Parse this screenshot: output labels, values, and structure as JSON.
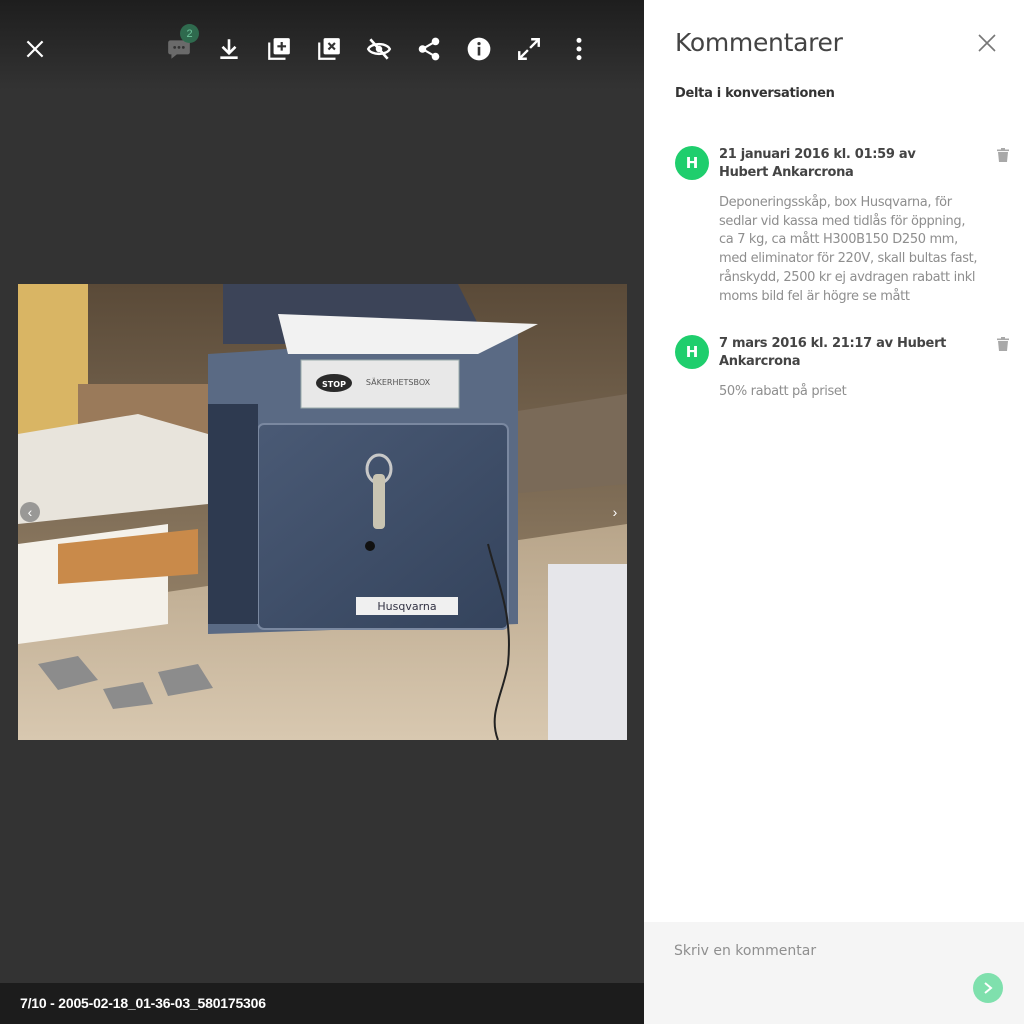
{
  "toolbar": {
    "comment_count": "2",
    "icons": [
      "close-icon",
      "comments-icon",
      "download-icon",
      "add-to-album-icon",
      "remove-from-album-icon",
      "hide-icon",
      "share-icon",
      "info-icon",
      "fullscreen-icon",
      "more-icon"
    ]
  },
  "viewer": {
    "caption": "7/10 - 2005-02-18_01-36-03_580175306",
    "prev_glyph": "‹",
    "next_glyph": "›",
    "photo_sticker_text": "SÄKERHETSBOX",
    "photo_brand_text": "Husqvarna"
  },
  "panel": {
    "title": "Kommentarer",
    "subtitle": "Delta i konversationen",
    "comments": [
      {
        "avatar": "H",
        "header": "21 januari 2016 kl. 01:59 av Hubert Ankarcrona",
        "body": "Deponeringsskåp, box Husqvarna, för sedlar vid kassa med tidlås för öppning, ca 7 kg, ca mått H300B150 D250 mm, med eliminator för 220V, skall bultas fast, rånskydd, 2500 kr ej avdragen rabatt inkl moms bild fel är högre se mått"
      },
      {
        "avatar": "H",
        "header": "7 mars 2016 kl. 21:17 av Hubert Ankarcrona",
        "body": "50% rabatt på priset"
      }
    ],
    "compose": {
      "placeholder": "Skriv en kommentar",
      "value": ""
    }
  },
  "colors": {
    "accent": "#1fce6d",
    "send_button": "#7fe0ad",
    "viewer_bg": "#333333",
    "panel_bg": "#ffffff"
  }
}
